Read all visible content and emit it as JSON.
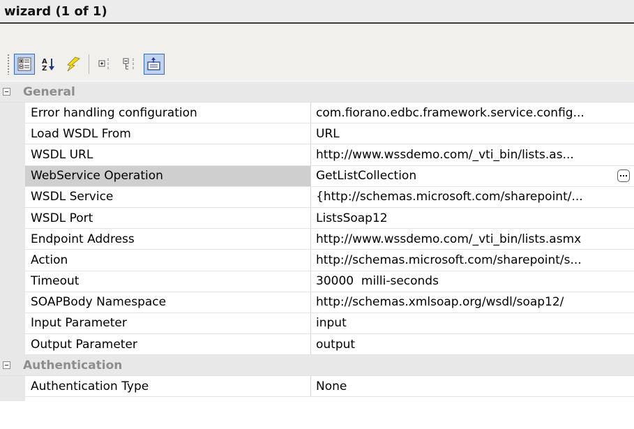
{
  "window": {
    "title": "wizard (1 of 1)"
  },
  "toolbar": {
    "buttons": [
      {
        "icon": "categorized-icon",
        "active": true
      },
      {
        "icon": "alphabetical-sort-icon",
        "active": false
      },
      {
        "icon": "events-lightning-icon",
        "active": false
      },
      {
        "icon": "expand-all-icon",
        "active": false
      },
      {
        "icon": "collapse-all-icon",
        "active": false
      },
      {
        "icon": "property-pages-icon",
        "active": true
      }
    ]
  },
  "categories": [
    {
      "name": "General",
      "properties": [
        {
          "name": "Error handling configuration",
          "value": "com.fiorano.edbc.framework.service.config..."
        },
        {
          "name": "Load WSDL From",
          "value": "URL"
        },
        {
          "name": "WSDL URL",
          "value": "http://www.wssdemo.com/_vti_bin/lists.as..."
        },
        {
          "name": "WebService Operation",
          "value": "GetListCollection"
        },
        {
          "name": "WSDL Service",
          "value": "{http://schemas.microsoft.com/sharepoint/..."
        },
        {
          "name": "WSDL Port",
          "value": "ListsSoap12"
        },
        {
          "name": "Endpoint Address",
          "value": "http://www.wssdemo.com/_vti_bin/lists.asmx"
        },
        {
          "name": "Action",
          "value": "http://schemas.microsoft.com/sharepoint/s..."
        },
        {
          "name": "Timeout",
          "value": "30000  milli-seconds"
        },
        {
          "name": "SOAPBody Namespace",
          "value": "http://schemas.xmlsoap.org/wsdl/soap12/"
        },
        {
          "name": "Input Parameter",
          "value": "input"
        },
        {
          "name": "Output Parameter",
          "value": "output"
        }
      ]
    },
    {
      "name": "Authentication",
      "properties": [
        {
          "name": "Authentication Type",
          "value": "None"
        }
      ]
    }
  ],
  "selected_property": "WebService Operation",
  "colors": {
    "selection": "#cfcfcf",
    "category_bg": "#e8e8e8",
    "toolbar_active_border": "#316ac5"
  }
}
